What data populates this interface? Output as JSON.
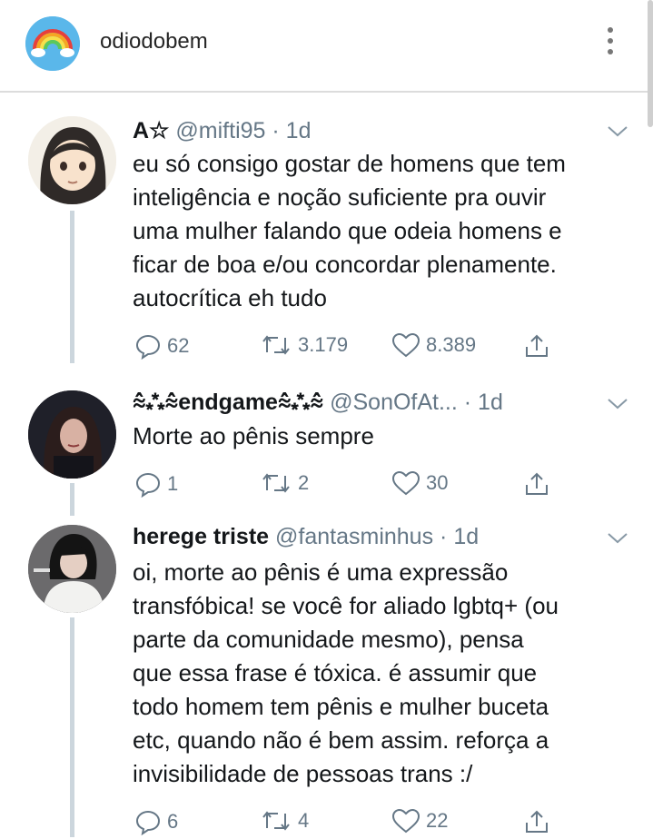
{
  "header": {
    "username": "odiodobem",
    "avatar_icon": "rainbow-icon",
    "menu_icon": "more-vertical-icon"
  },
  "tweets": [
    {
      "name": "A☆",
      "handle": "@mifti95",
      "time": "· 1d",
      "lines": [
        "eu só consigo gostar de homens que tem",
        "inteligência e noção suficiente pra ouvir",
        "uma mulher falando que odeia homens e",
        "ficar de boa e/ou concordar plenamente.",
        "autocrítica eh tudo"
      ],
      "replies": "62",
      "retweets": "3.179",
      "likes": "8.389"
    },
    {
      "name": "⩯⁂⩯endgame⩯⁂⩯",
      "handle": "@SonOfAt...",
      "time": "· 1d",
      "lines": [
        "Morte ao pênis sempre"
      ],
      "replies": "1",
      "retweets": "2",
      "likes": "30"
    },
    {
      "name": "herege triste",
      "handle": "@fantasminhus",
      "time": "· 1d",
      "lines": [
        "oi, morte ao pênis é uma expressão",
        "transfóbica! se você for aliado lgbtq+ (ou",
        "parte da comunidade mesmo), pensa",
        "que essa frase é tóxica. é assumir que",
        "todo homem tem pênis e mulher buceta",
        "etc, quando não é bem assim. reforça a",
        "invisibilidade de pessoas trans :/"
      ],
      "replies": "6",
      "retweets": "4",
      "likes": "22"
    }
  ],
  "colors": {
    "text": "#14171a",
    "secondary": "#657786",
    "thread": "#ccd6dd"
  }
}
